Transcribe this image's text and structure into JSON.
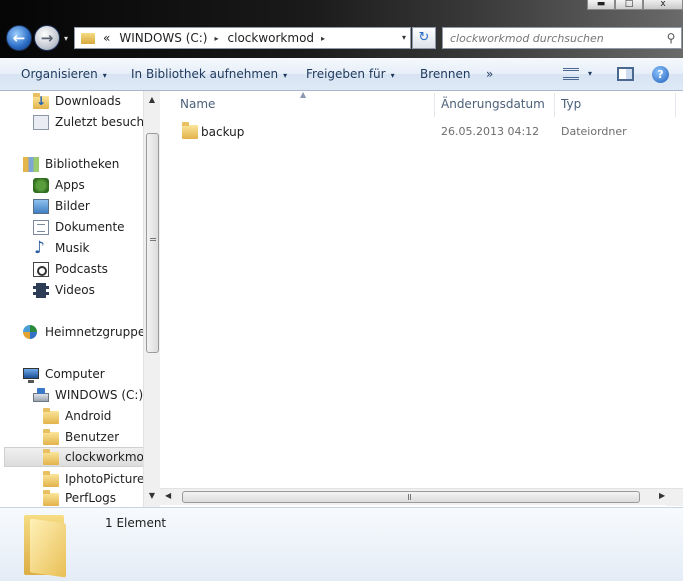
{
  "window": {
    "minimize": "▬",
    "maximize": "□",
    "close": "x"
  },
  "address": {
    "overflow": "«",
    "crumbs": [
      "WINDOWS (C:)",
      "clockworkmod"
    ],
    "separator": "▸",
    "dropdown": "▾"
  },
  "search": {
    "placeholder": "clockworkmod durchsuchen"
  },
  "toolbar": {
    "organize": "Organisieren",
    "include_library": "In Bibliothek aufnehmen",
    "share": "Freigeben für",
    "burn": "Brennen",
    "more": "»",
    "caret": "▾",
    "help": "?"
  },
  "nav": {
    "items": [
      {
        "label": "Downloads",
        "icon": "downloads-icon"
      },
      {
        "label": "Zuletzt besucht",
        "icon": "recent-places-icon"
      },
      {
        "label": "Bibliotheken",
        "icon": "libraries-icon"
      },
      {
        "label": "Apps",
        "icon": "apps-icon"
      },
      {
        "label": "Bilder",
        "icon": "pictures-icon"
      },
      {
        "label": "Dokumente",
        "icon": "documents-icon"
      },
      {
        "label": "Musik",
        "icon": "music-icon"
      },
      {
        "label": "Podcasts",
        "icon": "podcasts-icon"
      },
      {
        "label": "Videos",
        "icon": "videos-icon"
      },
      {
        "label": "Heimnetzgruppe",
        "icon": "homegroup-icon"
      },
      {
        "label": "Computer",
        "icon": "computer-icon"
      },
      {
        "label": "WINDOWS (C:)",
        "icon": "drive-icon"
      },
      {
        "label": "Android",
        "icon": "folder-icon"
      },
      {
        "label": "Benutzer",
        "icon": "folder-icon"
      },
      {
        "label": "clockworkmod",
        "icon": "folder-icon",
        "selected": true
      },
      {
        "label": "IphotoPictures",
        "icon": "folder-icon"
      },
      {
        "label": "PerfLogs",
        "icon": "folder-icon"
      }
    ]
  },
  "columns": {
    "name": "Name",
    "date": "Änderungsdatum",
    "type": "Typ"
  },
  "files": [
    {
      "name": "backup",
      "date": "26.05.2013 04:12",
      "type": "Dateiordner"
    }
  ],
  "details": {
    "count": "1 Element"
  }
}
